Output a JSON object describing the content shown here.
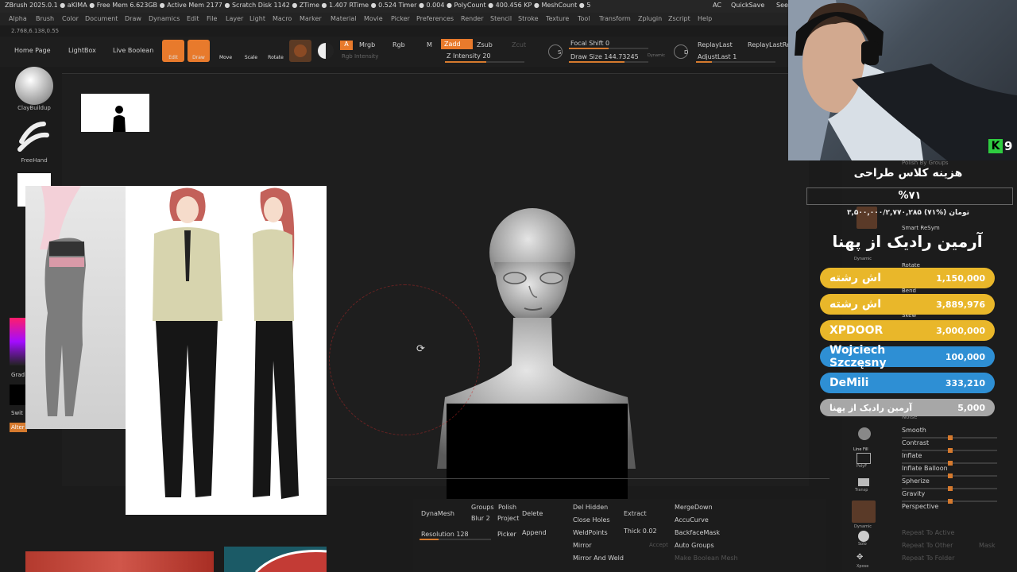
{
  "titlebar": {
    "text": "ZBrush 2025.0.1  ● aKIMA  ● Free Mem 6.623GB ● Active Mem 2177 ● Scratch Disk 1142 ● ZTime ● 1.407 RTime ● 0.524 Timer ● 0.004 ● PolyCount ● 400.456 KP ● MeshCount ● 5",
    "ac": "AC",
    "quicksave": "QuickSave",
    "see": "See"
  },
  "menu": [
    "Alpha",
    "Brush",
    "Color",
    "Document",
    "Draw",
    "Dynamics",
    "Edit",
    "File",
    "Layer",
    "Light",
    "Macro",
    "Marker",
    "Material",
    "Movie",
    "Picker",
    "Preferences",
    "Render",
    "Stencil",
    "Stroke",
    "Texture",
    "Tool",
    "Transform",
    "Zplugin",
    "Zscript",
    "Help"
  ],
  "coords": "2.768,6.138,0.55",
  "toolbar": {
    "home": "Home Page",
    "lightbox": "LightBox",
    "live_boolean": "Live Boolean",
    "edit": "Edit",
    "draw": "Draw",
    "move": "Move",
    "scale": "Scale",
    "rotate": "Rotate",
    "a": "A",
    "mrgb": "Mrgb",
    "rgb": "Rgb",
    "m": "M",
    "zadd": "Zadd",
    "zsub": "Zsub",
    "zcut": "Zcut",
    "rgb_intensity": "Rgb Intensity",
    "z_intensity": "Z Intensity 20",
    "focal_shift": "Focal Shift 0",
    "draw_size": "Draw Size 144.73245",
    "dynamic": "Dynamic",
    "replay_last": "ReplayLast",
    "replay_last_rel": "ReplayLastRel",
    "adjust_last": "AdjustLast 1",
    "s": "S",
    "d": "D"
  },
  "shelf": {
    "brush1": "ClayBuildup",
    "brush2": "FreeHand",
    "grad": "Grad",
    "swit": "Swit",
    "alter": "Alter"
  },
  "bottom": {
    "dynamesh": "DynaMesh",
    "groups": "Groups",
    "polish": "Polish",
    "blur": "Blur 2",
    "project": "Project",
    "resolution": "Resolution 128",
    "picker": "Picker",
    "delete": "Delete",
    "append": "Append",
    "del_hidden": "Del Hidden",
    "close_holes": "Close Holes",
    "weld_points": "WeldPoints",
    "mirror": "Mirror",
    "mirror_weld": "Mirror And Weld",
    "extract": "Extract",
    "thick": "Thick 0.02",
    "accept": "Accept",
    "merge_down": "MergeDown",
    "accucurve": "AccuCurve",
    "backface_mask": "BackfaceMask",
    "auto_groups": "Auto Groups",
    "make_boolean": "Make Boolean Mesh"
  },
  "right_panel": {
    "polish_groups": "Polish By Groups",
    "smart_resym": "Smart ReSym",
    "rotate": "Rotate",
    "bend": "Bend",
    "skew": "Skew",
    "noise": "Noise",
    "smooth": "Smooth",
    "contrast": "Contrast",
    "inflate": "Inflate",
    "inflate_balloon": "Inflate Balloon",
    "spherize": "Spherize",
    "gravity": "Gravity",
    "perspective": "Perspective",
    "repeat_active": "Repeat To Active",
    "repeat_other": "Repeat To Other",
    "repeat_folder": "Repeat To Folder",
    "mask": "Mask",
    "dynamic": "Dynamic",
    "line_fill": "Line Fill",
    "polyf": "PolyF",
    "transp": "Transp",
    "solo": "Solo",
    "dynamic2": "Dynamic",
    "xpose": "Xpose"
  },
  "overlay": {
    "k_count": "9",
    "goal_title": "هزینه کلاس طراحی",
    "goal_percent": "%۷۱",
    "goal_amount": "۳,۵۰۰,۰۰۰/۲,۷۷۰,۲۸۵ تومان (%۷۱)",
    "top_donor": "آرمین رادیک از پهنا",
    "donations": [
      {
        "name": "اش رشته",
        "value": "1,150,000",
        "color": "#e9b72a"
      },
      {
        "name": "اش رشته",
        "value": "3,889,976",
        "color": "#e9b72a"
      },
      {
        "name": "XPDOOR",
        "value": "3,000,000",
        "color": "#e9b72a"
      },
      {
        "name": "Wojciech Szczęsny",
        "value": "100,000",
        "color": "#2e8fd4"
      },
      {
        "name": "DeMili",
        "value": "333,210",
        "color": "#2e8fd4"
      },
      {
        "name": "آرمین رادیک از پهنا",
        "value": "5,000",
        "color": "#a7a7a7"
      }
    ]
  }
}
